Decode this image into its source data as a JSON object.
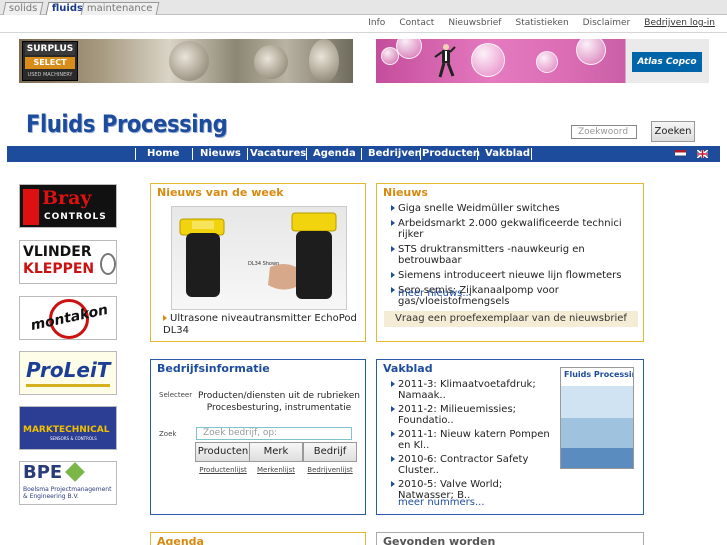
{
  "site_tabs": [
    "solids",
    "fluids",
    "maintenance"
  ],
  "utility_links": [
    "Info",
    "Contact",
    "Nieuwsbrief",
    "Statistieken",
    "Disclaimer",
    "Bedrijven log-in"
  ],
  "banners": {
    "left_logo_top": "SURPLUS",
    "left_logo_mid": "SELECT",
    "left_logo_bottom": "USED MACHINERY",
    "right_logo": "Atlas Copco"
  },
  "site_logo": "Fluids Processing",
  "search": {
    "placeholder": "Zoekwoord",
    "button": "Zoeken"
  },
  "nav": [
    "Home",
    "Nieuws",
    "Vacatures",
    "Agenda",
    "Bedrijven",
    "Producten",
    "Vakblad"
  ],
  "sponsors": {
    "bray": {
      "name": "Bray",
      "sub": "CONTROLS"
    },
    "vlinder": {
      "line1": "VLINDER",
      "line2": "KLEPPEN"
    },
    "montakon": "montakon",
    "proleit": "ProLeiT",
    "marktech": {
      "name": "MARKTECHNICAL",
      "sub": "SENSORS & CONTROLS"
    },
    "bpex": {
      "name": "BPE",
      "sub": "Boelsma Projectmanagement & Engineering B.V."
    }
  },
  "nieuws_week": {
    "title": "Nieuws van de week",
    "photo_label": "DL34 Shown",
    "caption": "Ultrasone niveautransmitter EchoPod DL34"
  },
  "nieuws": {
    "title": "Nieuws",
    "items": [
      "Giga snelle Weidmüller switches",
      "Arbeidsmarkt 2.000 gekwalificeerde technici rijker",
      "STS druktransmitters -nauwkeurig en betrouwbaar",
      "Siemens introduceert nieuwe lijn flowmeters",
      "Sero semis: Zijkanaalpomp voor gas/vloeistofmengsels"
    ],
    "more": "meer nieuws...",
    "cta": "Vraag een proefexemplaar van de nieuwsbrief"
  },
  "bedrijfsinfo": {
    "title": "Bedrijfsinformatie",
    "selecteer_label": "Selecteer",
    "selecteer_text": "Producten/diensten uit de rubrieken Procesbesturing, instrumentatie",
    "zoek_label": "Zoek",
    "zoek_placeholder": "Zoek bedrijf, op:",
    "buttons": [
      "Producten",
      "Merk",
      "Bedrijf"
    ],
    "links": [
      "Productenlijst",
      "Merkenlijst",
      "Bedrijvenlijst"
    ]
  },
  "vakblad": {
    "title": "Vakblad",
    "items": [
      "2011-3: Klimaatvoetafdruk; Namaak..",
      "2011-2: Milieuemissies; Foundatio..",
      "2011-1: Nieuw katern Pompen en Kl..",
      "2010-6: Contractor Safety Cluster..",
      "2010-5: Valve World; Natwasser; B.."
    ],
    "more": "meer nummers...",
    "cover_title": "Fluids Processing"
  },
  "agenda": {
    "title": "Agenda"
  },
  "gevonden": {
    "title": "Gevonden worden"
  },
  "colors": {
    "brand_blue": "#1e4c9c",
    "news_yellow": "#e4b830",
    "news_orange": "#d88a10"
  }
}
